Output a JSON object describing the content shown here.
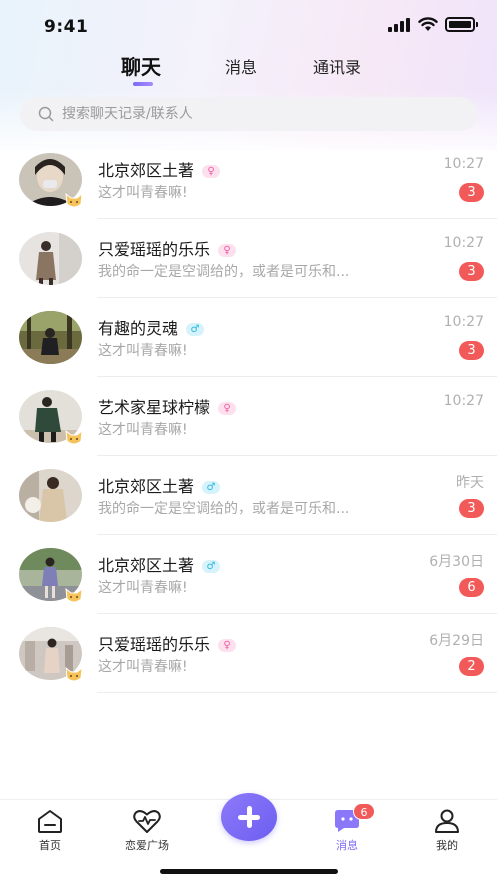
{
  "status_bar": {
    "time": "9:41"
  },
  "tabs": [
    {
      "label": "聊天",
      "active": true
    },
    {
      "label": "消息",
      "active": false
    },
    {
      "label": "通讯录",
      "active": false
    }
  ],
  "search": {
    "placeholder": "搜索聊天记录/联系人"
  },
  "chats": [
    {
      "name": "北京郊区土著",
      "gender": "female",
      "preview": "这才叫青春嘛!",
      "time": "10:27",
      "unread": "3"
    },
    {
      "name": "只爱瑶瑶的乐乐",
      "gender": "female",
      "preview": "我的命一定是空调给的，或者是可乐和...",
      "time": "10:27",
      "unread": "3"
    },
    {
      "name": "有趣的灵魂",
      "gender": "male",
      "preview": "这才叫青春嘛!",
      "time": "10:27",
      "unread": "3"
    },
    {
      "name": "艺术家星球柠檬",
      "gender": "female",
      "preview": "这才叫青春嘛!",
      "time": "10:27",
      "unread": ""
    },
    {
      "name": "北京郊区土著",
      "gender": "male",
      "preview": "我的命一定是空调给的，或者是可乐和...",
      "time": "昨天",
      "unread": "3"
    },
    {
      "name": "北京郊区土著",
      "gender": "male",
      "preview": "这才叫青春嘛!",
      "time": "6月30日",
      "unread": "6"
    },
    {
      "name": "只爱瑶瑶的乐乐",
      "gender": "female",
      "preview": "这才叫青春嘛!",
      "time": "6月29日",
      "unread": "2"
    }
  ],
  "gender_symbols": {
    "female": "♀",
    "male": "♂"
  },
  "tabbar": {
    "items": [
      {
        "label": "首页",
        "icon": "home-icon",
        "active": false
      },
      {
        "label": "恋爱广场",
        "icon": "heart-pulse-icon",
        "active": false
      },
      {
        "label": "",
        "icon": "plus-icon",
        "active": false
      },
      {
        "label": "消息",
        "icon": "chat-bubble-icon",
        "active": true,
        "badge": "6"
      },
      {
        "label": "我的",
        "icon": "profile-icon",
        "active": false
      }
    ]
  },
  "colors": {
    "accent": "#7b6bf7",
    "badge": "#f25a5a",
    "female": "#f05ca3",
    "male": "#2ab7de"
  }
}
